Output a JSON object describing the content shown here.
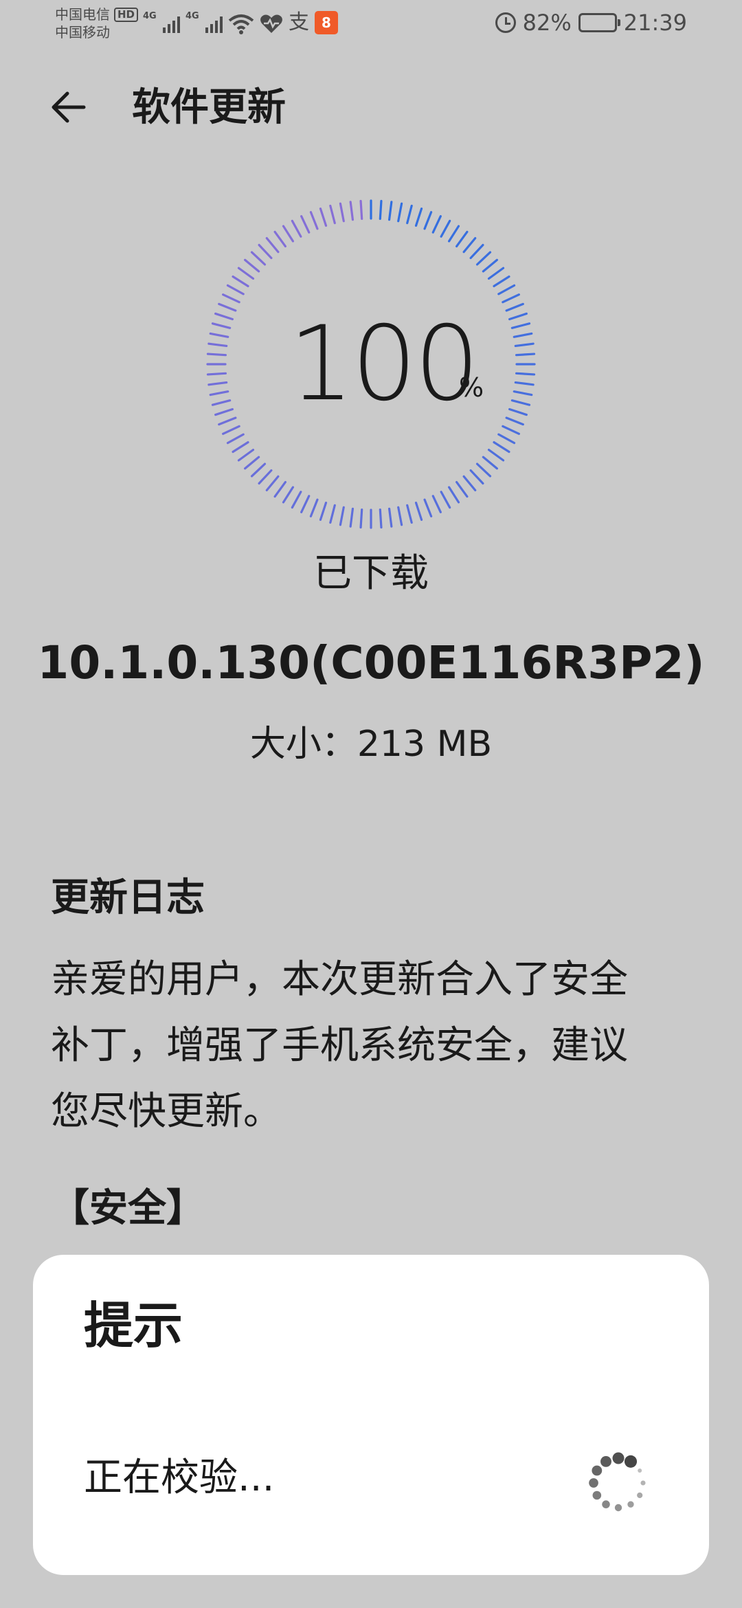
{
  "status_bar": {
    "carrier_1": "中国电信",
    "carrier_1_badge": "HD",
    "carrier_2": "中国移动",
    "network_1": "4G",
    "network_2": "4G",
    "battery_percent": "82%",
    "battery_level": 0.82,
    "time": "21:39",
    "icons": [
      "signal-icon",
      "wifi-icon",
      "health-heart-icon",
      "alipay-icon",
      "app-notification-icon",
      "alarm-icon",
      "battery-icon"
    ]
  },
  "header": {
    "title": "软件更新"
  },
  "download": {
    "progress_value": "100",
    "progress_unit": "%",
    "progress_fraction": 1.0,
    "status": "已下载",
    "version": "10.1.0.130(C00E116R3P2)",
    "size": "大小：213 MB"
  },
  "changelog": {
    "title": "更新日志",
    "lines": [
      "亲爱的用户，本次更新合入了安全",
      "补丁，增强了手机系统安全，建议",
      "您尽快更新。"
    ],
    "section": "【安全】"
  },
  "dialog": {
    "title": "提示",
    "message": "正在校验..."
  },
  "colors": {
    "background": "#cacaca",
    "dialog_background": "#ffffff",
    "text": "#1a1a1a",
    "ring_purple": "#8a6fd6",
    "ring_blue": "#2f6fe0",
    "app_badge": "#f05a28"
  }
}
